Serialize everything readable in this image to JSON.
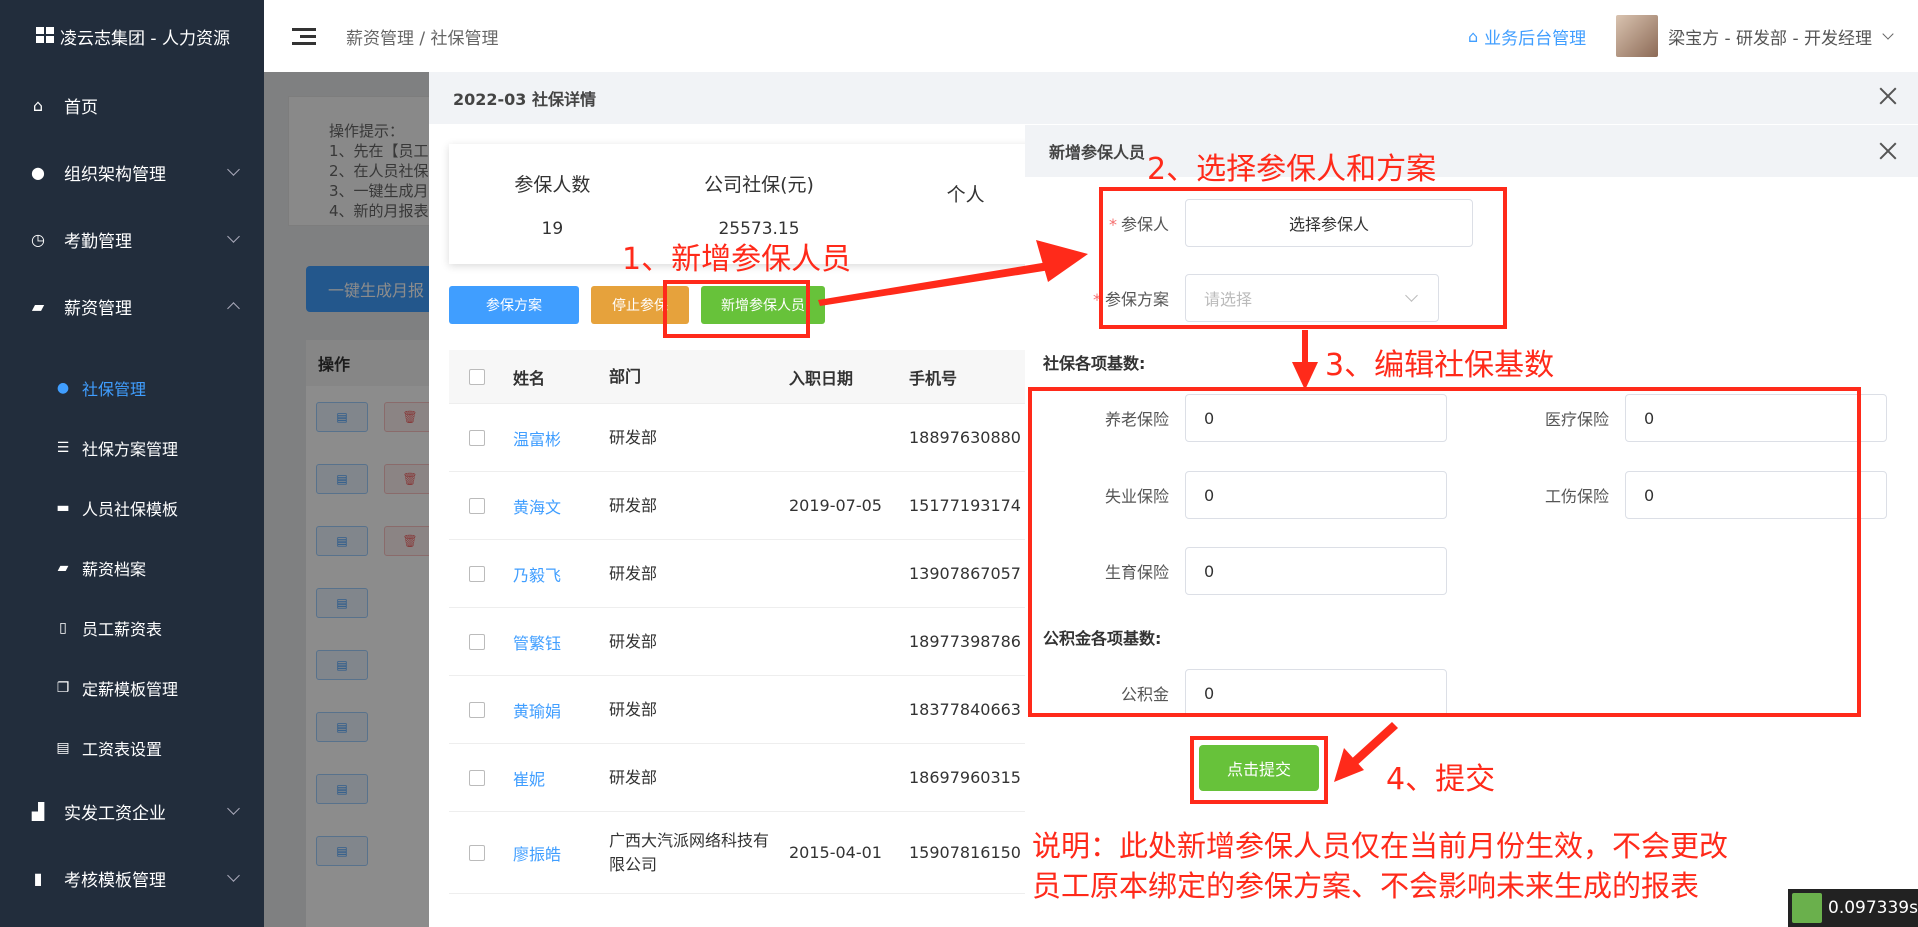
{
  "brand": {
    "title": "凌云志集团 - 人力资源"
  },
  "sidebar": {
    "items": [
      {
        "label": "首页",
        "icon": "home-icon"
      },
      {
        "label": "组织架构管理",
        "icon": "user-icon"
      },
      {
        "label": "考勤管理",
        "icon": "clock-icon"
      },
      {
        "label": "薪资管理",
        "icon": "wallet-icon"
      }
    ],
    "sub_items": [
      {
        "label": "社保管理",
        "icon": "drop-icon",
        "active": true
      },
      {
        "label": "社保方案管理",
        "icon": "sliders-icon"
      },
      {
        "label": "人员社保模板",
        "icon": "briefcase-icon"
      },
      {
        "label": "薪资档案",
        "icon": "wallet-icon"
      },
      {
        "label": "员工薪资表",
        "icon": "book-icon"
      },
      {
        "label": "定薪模板管理",
        "icon": "copy-icon"
      },
      {
        "label": "工资表设置",
        "icon": "list-icon"
      }
    ],
    "bottom_items": [
      {
        "label": "实发工资企业",
        "icon": "chart-icon"
      },
      {
        "label": "考核模板管理",
        "icon": "bars-icon"
      }
    ]
  },
  "header": {
    "breadcrumb": "薪资管理 / 社保管理",
    "backend_link": "业务后台管理",
    "user": "梁宝方 - 研发部 - 开发经理"
  },
  "main": {
    "tip_lines": [
      "操作提示：",
      "1、先在【员工",
      "2、在人员社保",
      "3、一键生成月",
      "4、新的月报表"
    ],
    "generate_button": "一键生成月报",
    "table_header": "操作",
    "row_buttons": {
      "edit": "▤",
      "delete": "🗑"
    }
  },
  "dialog": {
    "title": "2022-03 社保详情",
    "stats": [
      {
        "label": "参保人数",
        "value": "19"
      },
      {
        "label": "公司社保(元)",
        "value": "25573.15"
      },
      {
        "label": "个人",
        "value": ""
      }
    ],
    "toolbar": {
      "scheme": "参保方案",
      "stop": "停止参保",
      "add": "新增参保人员"
    },
    "columns": [
      "姓名",
      "部门",
      "入职日期",
      "手机号"
    ],
    "rows": [
      {
        "name": "温富彬",
        "dept": "研发部",
        "date": "",
        "phone": "18897630880"
      },
      {
        "name": "黄海文",
        "dept": "研发部",
        "date": "2019-07-05",
        "phone": "15177193174"
      },
      {
        "name": "乃毅飞",
        "dept": "研发部",
        "date": "",
        "phone": "13907867057"
      },
      {
        "name": "管繁钰",
        "dept": "研发部",
        "date": "",
        "phone": "18977398786"
      },
      {
        "name": "黄瑜娟",
        "dept": "研发部",
        "date": "",
        "phone": "18377840663"
      },
      {
        "name": "崔妮",
        "dept": "研发部",
        "date": "",
        "phone": "18697960315"
      },
      {
        "name": "廖振皓",
        "dept": "广西大汽派网络科技有限公司",
        "date": "2015-04-01",
        "phone": "15907816150"
      }
    ]
  },
  "dialog2": {
    "title": "新增参保人员",
    "insured_label": "参保人",
    "insured_button": "选择参保人",
    "scheme_label": "参保方案",
    "scheme_placeholder": "请选择",
    "social_title": "社保各项基数:",
    "fields": {
      "pension": {
        "label": "养老保险",
        "value": "0"
      },
      "medical": {
        "label": "医疗保险",
        "value": "0"
      },
      "unemployment": {
        "label": "失业保险",
        "value": "0"
      },
      "injury": {
        "label": "工伤保险",
        "value": "0"
      },
      "maternity": {
        "label": "生育保险",
        "value": "0"
      },
      "fund": {
        "label": "公积金",
        "value": "0"
      }
    },
    "fund_title": "公积金各项基数:",
    "submit": "点击提交"
  },
  "annotations": {
    "step1": "1、新增参保人员",
    "step2": "2、选择参保人和方案",
    "step3": "3、编辑社保基数",
    "step4": "4、提交",
    "note_line1": "说明：此处新增参保人员仅在当前月份生效，不会更改",
    "note_line2": "员工原本绑定的参保方案、不会影响未来生成的报表"
  },
  "timer": "0.097339s",
  "colors": {
    "annotation": "#ff2a1a",
    "primary": "#409eff",
    "success": "#67c23a",
    "warning": "#e6a23c",
    "sidebar": "#222d3c"
  }
}
